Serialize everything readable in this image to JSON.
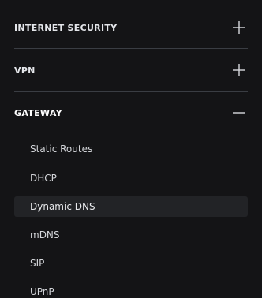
{
  "sections": [
    {
      "label": "INTERNET SECURITY",
      "icon": "plus-icon",
      "expanded": false
    },
    {
      "label": "VPN",
      "icon": "plus-icon",
      "expanded": false
    },
    {
      "label": "GATEWAY",
      "icon": "minus-icon",
      "expanded": true
    }
  ],
  "gateway_items": [
    {
      "label": "Static Routes"
    },
    {
      "label": "DHCP"
    },
    {
      "label": "Dynamic DNS",
      "selected": true
    },
    {
      "label": "mDNS"
    },
    {
      "label": "SIP"
    },
    {
      "label": "UPnP"
    }
  ],
  "colors": {
    "background": "#141416",
    "divider": "#3a3d43",
    "text": "#e4e6ea",
    "selected_row": "#222326"
  }
}
